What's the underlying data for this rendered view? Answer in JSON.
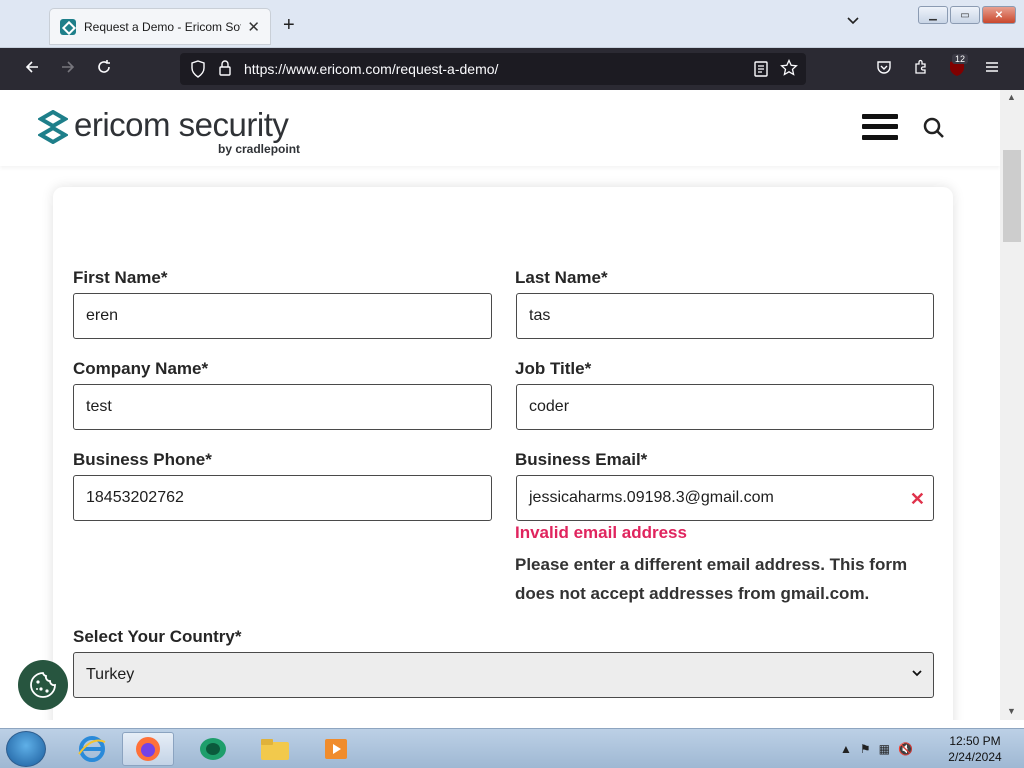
{
  "browser": {
    "tab_title": "Request a Demo - Ericom Softw",
    "url": "https://www.ericom.com/request-a-demo/",
    "extension_badge": "12"
  },
  "site": {
    "logo_text": "ericom security",
    "logo_sub": "by cradlepoint"
  },
  "form": {
    "first_name": {
      "label": "First Name*",
      "value": "eren"
    },
    "last_name": {
      "label": "Last Name*",
      "value": "tas"
    },
    "company_name": {
      "label": "Company Name*",
      "value": "test"
    },
    "job_title": {
      "label": "Job Title*",
      "value": "coder"
    },
    "business_phone": {
      "label": "Business Phone*",
      "value": "18453202762"
    },
    "business_email": {
      "label": "Business Email*",
      "value": "jessicaharms.09198.3@gmail.com"
    },
    "email_error": "Invalid email address",
    "email_help": "Please enter a different email address. This form does not accept addresses from gmail.com.",
    "country": {
      "label": "Select Your Country*",
      "value": "Turkey"
    }
  },
  "taskbar": {
    "time": "12:50 PM",
    "date": "2/24/2024"
  },
  "colors": {
    "brand_teal": "#1e7f8a",
    "error_red": "#e0245e",
    "browser_dark": "#2b2a33"
  }
}
